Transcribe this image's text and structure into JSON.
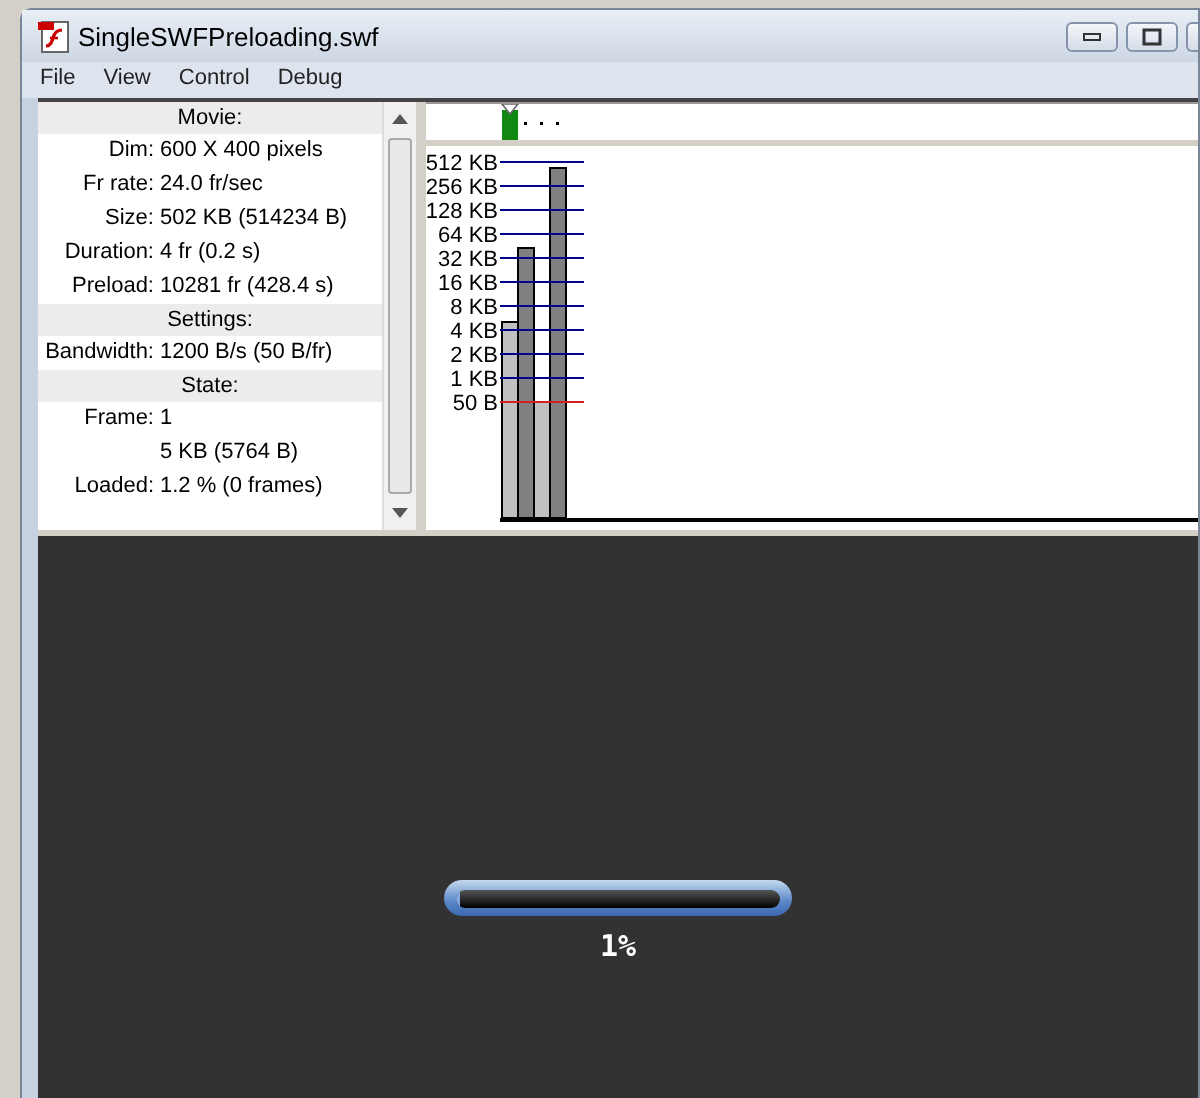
{
  "window": {
    "title": "SingleSWFPreloading.swf"
  },
  "menu": [
    "File",
    "View",
    "Control",
    "Debug"
  ],
  "info": [
    {
      "kind": "header",
      "text": "Movie:"
    },
    {
      "kind": "field",
      "label": "Dim:",
      "value": "600 X 400 pixels"
    },
    {
      "kind": "field",
      "label": "Fr rate:",
      "value": "24.0 fr/sec"
    },
    {
      "kind": "field",
      "label": "Size:",
      "value": "502 KB (514234 B)"
    },
    {
      "kind": "field",
      "label": "Duration:",
      "value": "4 fr (0.2 s)"
    },
    {
      "kind": "field",
      "label": "Preload:",
      "value": "10281 fr (428.4 s)"
    },
    {
      "kind": "header",
      "text": "Settings:"
    },
    {
      "kind": "field",
      "label": "Bandwidth:",
      "value": "1200 B/s (50 B/fr)"
    },
    {
      "kind": "header",
      "text": "State:"
    },
    {
      "kind": "field",
      "label": "Frame:",
      "value": "1"
    },
    {
      "kind": "field",
      "value": "5 KB (5764 B)"
    },
    {
      "kind": "field",
      "label": "Loaded:",
      "value": "1.2 % (0 frames)"
    }
  ],
  "timeline": {
    "frames": [
      {
        "selected": true
      },
      {
        "selected": false
      },
      {
        "selected": false
      },
      {
        "selected": false
      }
    ]
  },
  "graph": {
    "axis_labels": [
      "512 KB",
      "256 KB",
      "128 KB",
      "64 KB",
      "32 KB",
      "16 KB",
      "8 KB",
      "4 KB",
      "2 KB",
      "1 KB",
      "50 B"
    ]
  },
  "preloader": {
    "level": 0.01,
    "reading": "1%"
  }
}
